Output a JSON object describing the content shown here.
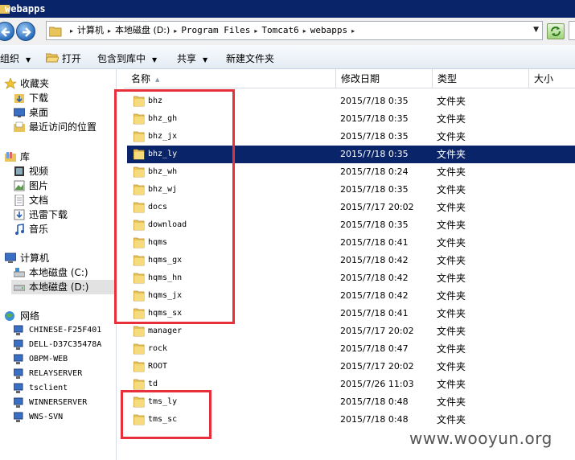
{
  "window": {
    "title": "webapps"
  },
  "address": {
    "crumbs": [
      "计算机",
      "本地磁盘 (D:)",
      "Program Files",
      "Tomcat6",
      "webapps"
    ]
  },
  "toolbar": {
    "organize": "组织",
    "open": "打开",
    "include_in_library": "包含到库中",
    "share": "共享",
    "new_folder": "新建文件夹"
  },
  "nav": {
    "favorites": "收藏夹",
    "fav_items": [
      "下载",
      "桌面",
      "最近访问的位置"
    ],
    "libraries": "库",
    "lib_items": [
      "视频",
      "图片",
      "文档",
      "迅雷下载",
      "音乐"
    ],
    "computer": "计算机",
    "drives": [
      "本地磁盘 (C:)",
      "本地磁盘 (D:)"
    ],
    "network": "网络",
    "net_items": [
      "CHINESE-F25F401",
      "DELL-D37C35478A",
      "OBPM-WEB",
      "RELAYSERVER",
      "tsclient",
      "WINNERSERVER",
      "WNS-SVN"
    ]
  },
  "columns": {
    "name": "名称",
    "date": "修改日期",
    "type": "类型",
    "size": "大小"
  },
  "files": [
    {
      "name": "bhz",
      "date": "2015/7/18 0:35",
      "type": "文件夹"
    },
    {
      "name": "bhz_gh",
      "date": "2015/7/18 0:35",
      "type": "文件夹"
    },
    {
      "name": "bhz_jx",
      "date": "2015/7/18 0:35",
      "type": "文件夹"
    },
    {
      "name": "bhz_ly",
      "date": "2015/7/18 0:35",
      "type": "文件夹",
      "selected": true
    },
    {
      "name": "bhz_wh",
      "date": "2015/7/18 0:24",
      "type": "文件夹"
    },
    {
      "name": "bhz_wj",
      "date": "2015/7/18 0:35",
      "type": "文件夹"
    },
    {
      "name": "docs",
      "date": "2015/7/17 20:02",
      "type": "文件夹"
    },
    {
      "name": "download",
      "date": "2015/7/18 0:35",
      "type": "文件夹"
    },
    {
      "name": "hqms",
      "date": "2015/7/18 0:41",
      "type": "文件夹"
    },
    {
      "name": "hqms_gx",
      "date": "2015/7/18 0:42",
      "type": "文件夹"
    },
    {
      "name": "hqms_hn",
      "date": "2015/7/18 0:42",
      "type": "文件夹"
    },
    {
      "name": "hqms_jx",
      "date": "2015/7/18 0:42",
      "type": "文件夹"
    },
    {
      "name": "hqms_sx",
      "date": "2015/7/18 0:41",
      "type": "文件夹"
    },
    {
      "name": "manager",
      "date": "2015/7/17 20:02",
      "type": "文件夹"
    },
    {
      "name": "rock",
      "date": "2015/7/18 0:47",
      "type": "文件夹"
    },
    {
      "name": "ROOT",
      "date": "2015/7/17 20:02",
      "type": "文件夹"
    },
    {
      "name": "td",
      "date": "2015/7/26 11:03",
      "type": "文件夹"
    },
    {
      "name": "tms_ly",
      "date": "2015/7/18 0:48",
      "type": "文件夹"
    },
    {
      "name": "tms_sc",
      "date": "2015/7/18 0:48",
      "type": "文件夹"
    }
  ],
  "watermark": "www.wooyun.org",
  "colors": {
    "selection": "#0a246a",
    "annotation": "#e8303a"
  }
}
